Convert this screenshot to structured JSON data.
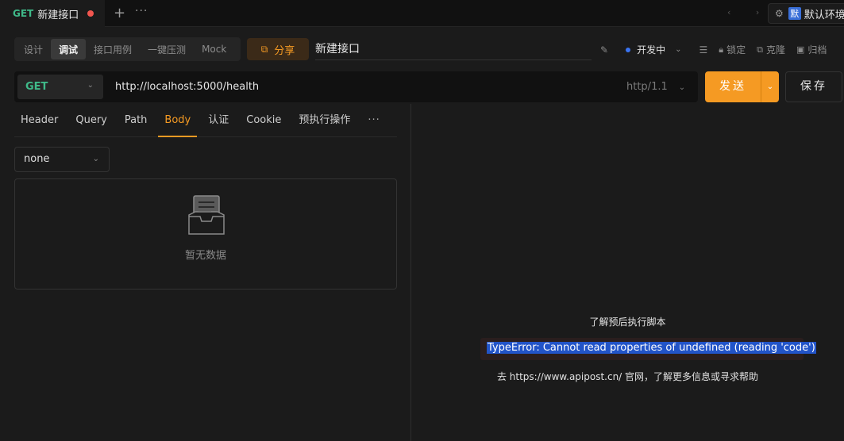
{
  "tab": {
    "method": "GET",
    "title": "新建接口",
    "add_icon": "+",
    "more_icon": "···"
  },
  "nav": {
    "arrows": "‹ ›"
  },
  "env": {
    "badge": "默",
    "name": "默认环境"
  },
  "modes": [
    "设计",
    "调试",
    "接口用例",
    "一键压测",
    "Mock"
  ],
  "active_mode": "调试",
  "share": {
    "label": "分享"
  },
  "api_name": "新建接口",
  "tools": {
    "status": "开发中",
    "lock": "锁定",
    "clone": "克隆",
    "archive": "归档"
  },
  "request": {
    "method": "GET",
    "url": "http://localhost:5000/health",
    "http_version": "http/1.1",
    "send_label": "发送",
    "save_label": "保存"
  },
  "req_tabs": [
    "Header",
    "Query",
    "Path",
    "Body",
    "认证",
    "Cookie",
    "预执行操作"
  ],
  "active_req_tab": "Body",
  "body": {
    "type": "none",
    "empty_text": "暂无数据"
  },
  "response": {
    "title": "了解预后执行脚本",
    "error": "TypeError: Cannot read properties of undefined (reading 'code')",
    "help": "去 https://www.apipost.cn/ 官网，了解更多信息或寻求帮助"
  },
  "colors": {
    "accent": "#f59a23",
    "get": "#3fb989",
    "selection": "#2254c8",
    "dirty": "#f2564f"
  }
}
